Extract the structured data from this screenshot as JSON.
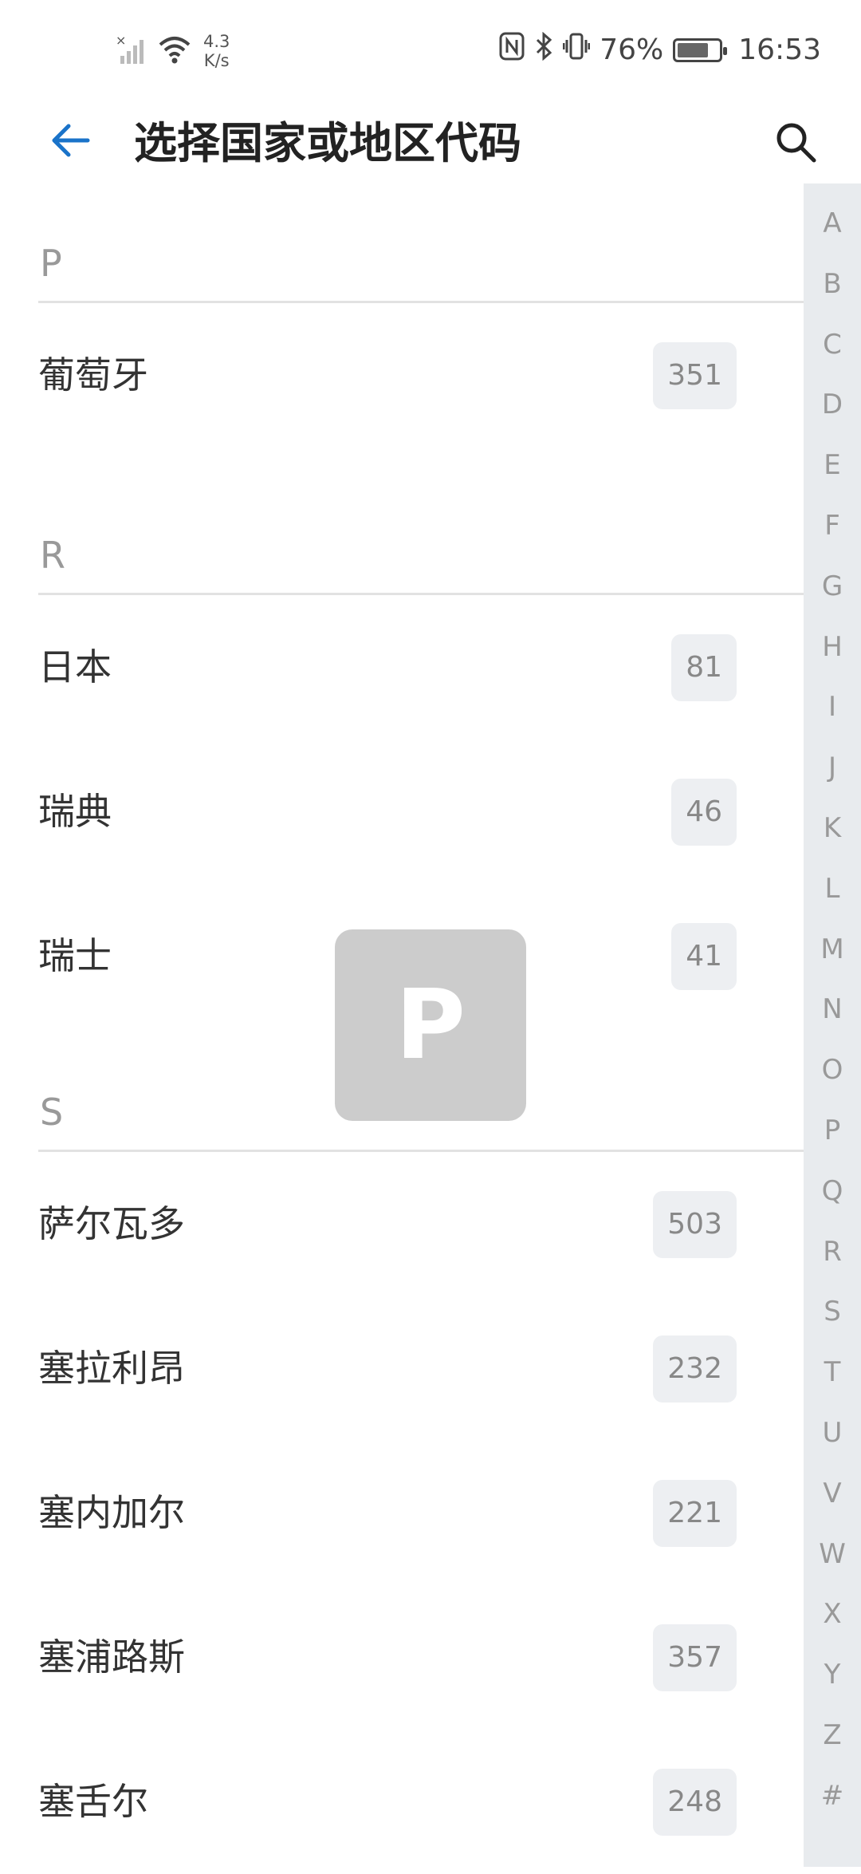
{
  "status_bar": {
    "net_speed_value": "4.3",
    "net_speed_unit": "K/s",
    "battery_percent": "76%",
    "time": "16:53",
    "battery_level": 0.76,
    "icons": [
      "signal-off-icon",
      "wifi-icon",
      "nfc-icon",
      "bluetooth-icon",
      "vibrate-icon",
      "battery-charging-icon"
    ]
  },
  "app_bar": {
    "title": "选择国家或地区代码",
    "back_icon": "arrow-left-icon",
    "search_icon": "search-icon",
    "accent": "#1a73c9"
  },
  "list": {
    "sections": [
      {
        "letter": "P",
        "items": [
          {
            "name": "葡萄牙",
            "code": "351"
          }
        ]
      },
      {
        "letter": "R",
        "items": [
          {
            "name": "日本",
            "code": "81"
          },
          {
            "name": "瑞典",
            "code": "46"
          },
          {
            "name": "瑞士",
            "code": "41"
          }
        ]
      },
      {
        "letter": "S",
        "items": [
          {
            "name": "萨尔瓦多",
            "code": "503"
          },
          {
            "name": "塞拉利昂",
            "code": "232"
          },
          {
            "name": "塞内加尔",
            "code": "221"
          },
          {
            "name": "塞浦路斯",
            "code": "357"
          },
          {
            "name": "塞舌尔",
            "code": "248"
          }
        ]
      }
    ]
  },
  "index_bar": {
    "letters": [
      "A",
      "B",
      "C",
      "D",
      "E",
      "F",
      "G",
      "H",
      "I",
      "J",
      "K",
      "L",
      "M",
      "N",
      "O",
      "P",
      "Q",
      "R",
      "S",
      "T",
      "U",
      "V",
      "W",
      "X",
      "Y",
      "Z",
      "#"
    ]
  },
  "overlay": {
    "letter": "P"
  }
}
